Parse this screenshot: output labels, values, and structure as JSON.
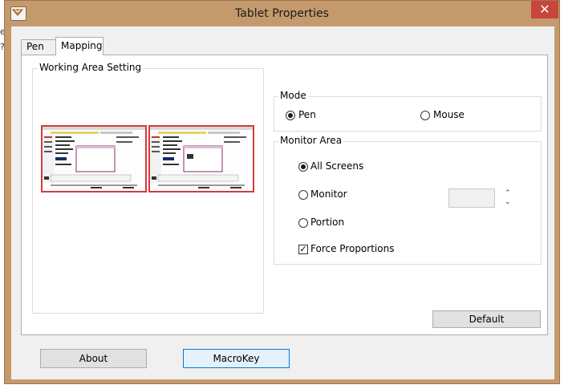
{
  "background": {
    "fragments": [
      "e",
      "?"
    ]
  },
  "window": {
    "title": "Tablet Properties",
    "close_glyph": "✕",
    "accent_color": "#c49a6c",
    "close_color": "#c7463b"
  },
  "tabs": [
    {
      "label": "Pen",
      "active": false
    },
    {
      "label": "Mapping",
      "active": true
    }
  ],
  "working_area": {
    "label": "Working Area Setting"
  },
  "mode": {
    "label": "Mode",
    "options": [
      {
        "label": "Pen",
        "selected": true
      },
      {
        "label": "Mouse",
        "selected": false
      }
    ]
  },
  "monitor_area": {
    "label": "Monitor Area",
    "options": [
      {
        "label": "All Screens",
        "selected": true
      },
      {
        "label": "Monitor",
        "selected": false
      },
      {
        "label": "Portion",
        "selected": false
      }
    ],
    "monitor_value": "",
    "spin_up": "⌃",
    "spin_down": "⌄",
    "force_proportions": {
      "label": "Force Proportions",
      "checked": true,
      "glyph": "✓"
    }
  },
  "buttons": {
    "default": "Default",
    "about": "About",
    "macrokey": "MacroKey"
  }
}
